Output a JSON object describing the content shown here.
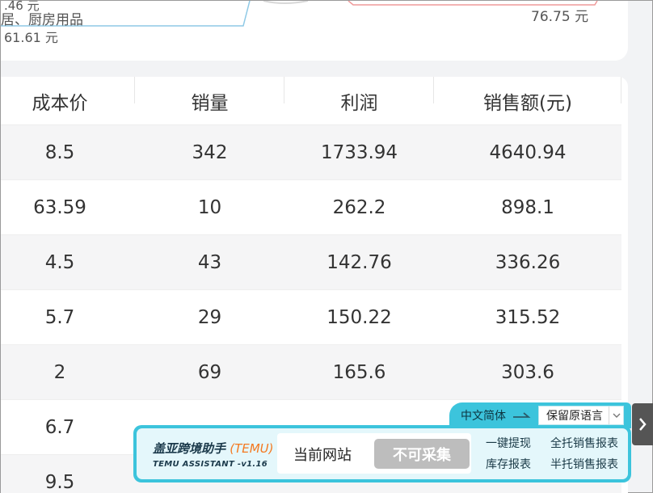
{
  "chart_labels": {
    "a": ".46 元",
    "b": "居、厨房用品",
    "c": "61.61 元",
    "d": "76.75 元"
  },
  "table": {
    "headers": [
      "成本价",
      "销量",
      "利润",
      "销售额(元)"
    ],
    "rows": [
      [
        "8.5",
        "342",
        "1733.94",
        "4640.94"
      ],
      [
        "63.59",
        "10",
        "262.2",
        "898.1"
      ],
      [
        "4.5",
        "43",
        "142.76",
        "336.26"
      ],
      [
        "5.7",
        "29",
        "150.22",
        "315.52"
      ],
      [
        "2",
        "69",
        "165.6",
        "303.6"
      ],
      [
        "6.7",
        "",
        "",
        ""
      ],
      [
        "9.5",
        "",
        "",
        ""
      ]
    ]
  },
  "assistant": {
    "lang_label": "中文简体",
    "lang_select": "保留原语言",
    "brand_title": "盖亚跨境助手",
    "brand_tag": "(TEMU)",
    "brand_sub": "TEMU ASSISTANT -v1.16",
    "site_label": "当前网站",
    "collect_button": "不可采集",
    "links": [
      "一键提现",
      "全托销售报表",
      "库存报表",
      "半托销售报表"
    ]
  },
  "colors": {
    "accent": "#3cc4dc",
    "disabled": "#bdbdbd",
    "brand_orange": "#f47920"
  }
}
